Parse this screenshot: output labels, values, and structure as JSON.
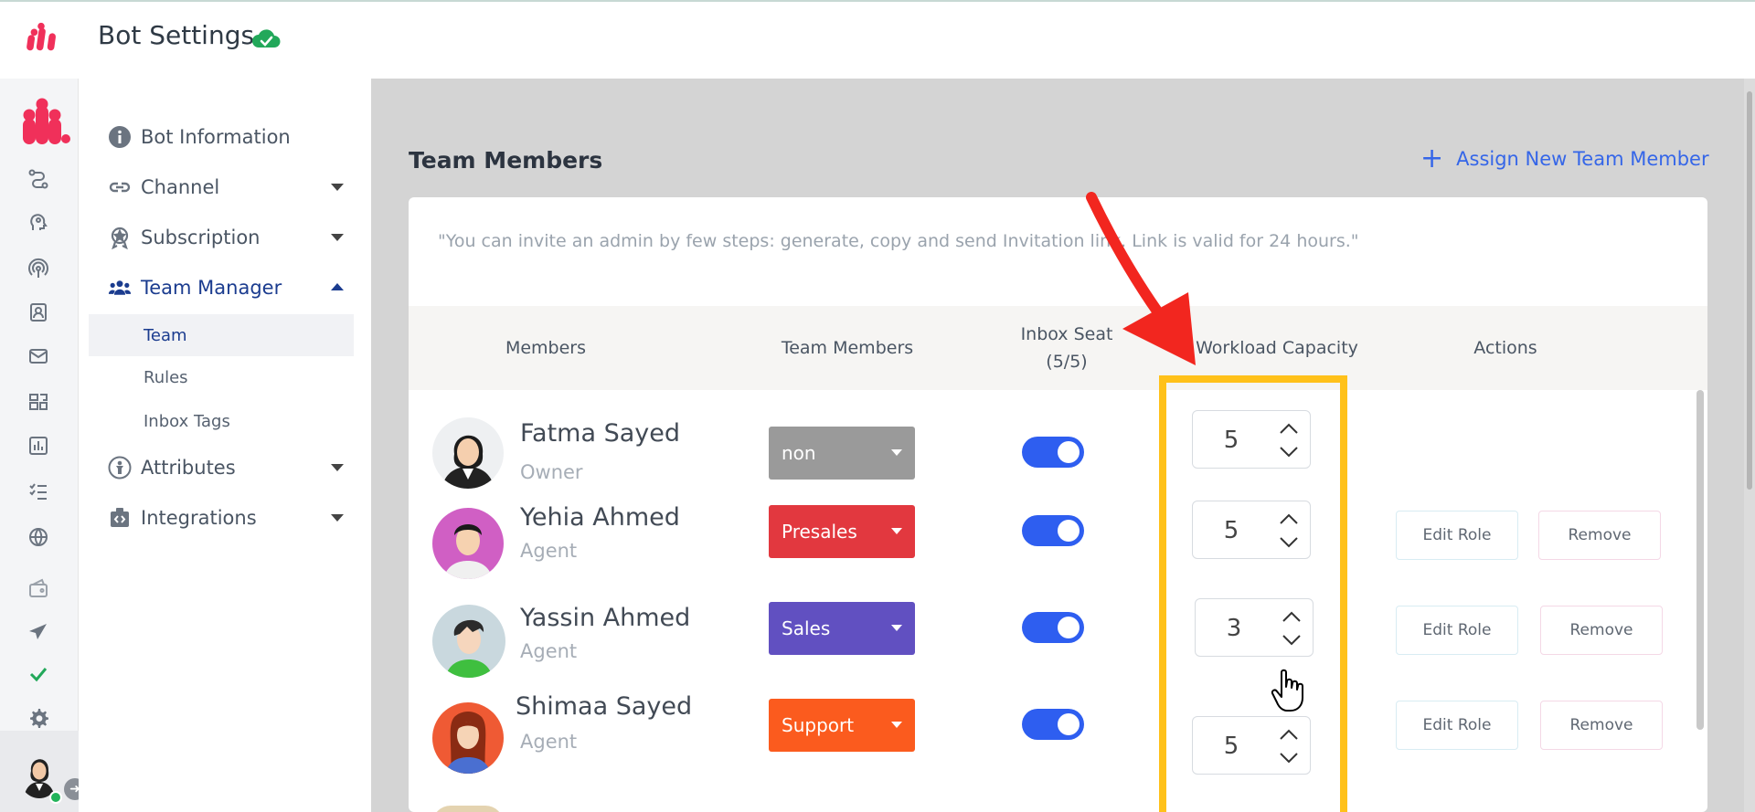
{
  "header": {
    "title": "Bot Settings"
  },
  "sidebar": {
    "items": [
      {
        "label": "Bot Information",
        "icon": "info-icon"
      },
      {
        "label": "Channel",
        "icon": "link-icon"
      },
      {
        "label": "Subscription",
        "icon": "badge-icon"
      },
      {
        "label": "Team Manager",
        "icon": "team-icon"
      },
      {
        "label": "Attributes",
        "icon": "person-icon"
      },
      {
        "label": "Integrations",
        "icon": "integration-icon"
      }
    ],
    "team_manager_sub": [
      {
        "label": "Team"
      },
      {
        "label": "Rules"
      },
      {
        "label": "Inbox Tags"
      }
    ]
  },
  "main": {
    "section_title": "Team Members",
    "assign_label": "Assign New Team Member",
    "hint": "\"You can invite an admin by few steps: generate, copy and send Invitation link. Link is valid for 24 hours.\"",
    "columns": {
      "members": "Members",
      "team_members": "Team Members",
      "inbox_seat": "Inbox Seat",
      "inbox_seat_count": "(5/5)",
      "workload": "Workload Capacity",
      "actions": "Actions"
    },
    "rows": [
      {
        "name": "Fatma Sayed",
        "role": "Owner",
        "team": "non",
        "team_color": "#9a9a9a",
        "seat_on": true,
        "capacity": "5"
      },
      {
        "name": "Yehia Ahmed",
        "role": "Agent",
        "team": "Presales",
        "team_color": "#e2383f",
        "seat_on": true,
        "capacity": "5",
        "edit_label": "Edit Role",
        "remove_label": "Remove"
      },
      {
        "name": "Yassin Ahmed",
        "role": "Agent",
        "team": "Sales",
        "team_color": "#6150c1",
        "seat_on": true,
        "capacity": "3",
        "edit_label": "Edit Role",
        "remove_label": "Remove"
      },
      {
        "name": "Shimaa Sayed",
        "role": "Agent",
        "team": "Support",
        "team_color": "#fb5b1e",
        "seat_on": true,
        "capacity": "5",
        "edit_label": "Edit Role",
        "remove_label": "Remove"
      }
    ]
  },
  "colors": {
    "brand": "#f0305a",
    "accent": "#3566e8",
    "highlight": "#ffc11a",
    "arrow": "#f2261f"
  }
}
